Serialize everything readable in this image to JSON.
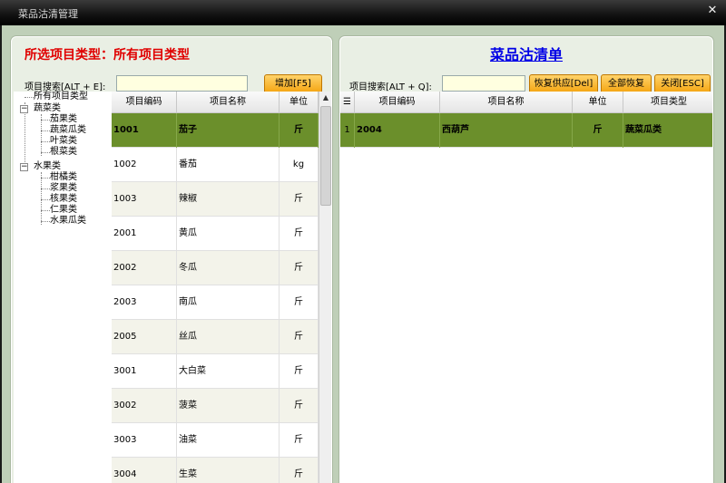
{
  "window": {
    "title": "菜品沽清管理",
    "close_glyph": "✕"
  },
  "left": {
    "selected_type_label": "所选项目类型：所有项目类型",
    "search_label": "项目搜索[ALT + E]:",
    "search_value": "",
    "add_button": "增加[F5]",
    "tree": {
      "root": "所有项目类型",
      "groups": [
        {
          "label": "蔬菜类",
          "children": [
            "茄果类",
            "蔬菜瓜类",
            "叶菜类",
            "根菜类"
          ]
        },
        {
          "label": "水果类",
          "children": [
            "柑橘类",
            "浆果类",
            "核果类",
            "仁果类",
            "水果瓜类"
          ]
        }
      ]
    },
    "table": {
      "columns": [
        "项目编码",
        "项目名称",
        "单位"
      ],
      "rows": [
        {
          "code": "1001",
          "name": "茄子",
          "unit": "斤"
        },
        {
          "code": "1002",
          "name": "番茄",
          "unit": "kg"
        },
        {
          "code": "1003",
          "name": "辣椒",
          "unit": "斤"
        },
        {
          "code": "2001",
          "name": "黄瓜",
          "unit": "斤"
        },
        {
          "code": "2002",
          "name": "冬瓜",
          "unit": "斤"
        },
        {
          "code": "2003",
          "name": "南瓜",
          "unit": "斤"
        },
        {
          "code": "2005",
          "name": "丝瓜",
          "unit": "斤"
        },
        {
          "code": "3001",
          "name": "大白菜",
          "unit": "斤"
        },
        {
          "code": "3002",
          "name": "菠菜",
          "unit": "斤"
        },
        {
          "code": "3003",
          "name": "油菜",
          "unit": "斤"
        },
        {
          "code": "3004",
          "name": "生菜",
          "unit": "斤"
        }
      ]
    }
  },
  "right": {
    "title": "菜品沽清单",
    "search_label": "项目搜索[ALT + Q]:",
    "search_value": "",
    "buttons": {
      "restore": "恢复供应[Del]",
      "restore_all": "全部恢复",
      "close": "关闭[ESC]"
    },
    "table": {
      "columns": [
        "项目编码",
        "项目名称",
        "单位",
        "项目类型"
      ],
      "rows": [
        {
          "index": "1",
          "code": "2004",
          "name": "西葫芦",
          "unit": "斤",
          "type": "蔬菜瓜类"
        }
      ]
    }
  }
}
